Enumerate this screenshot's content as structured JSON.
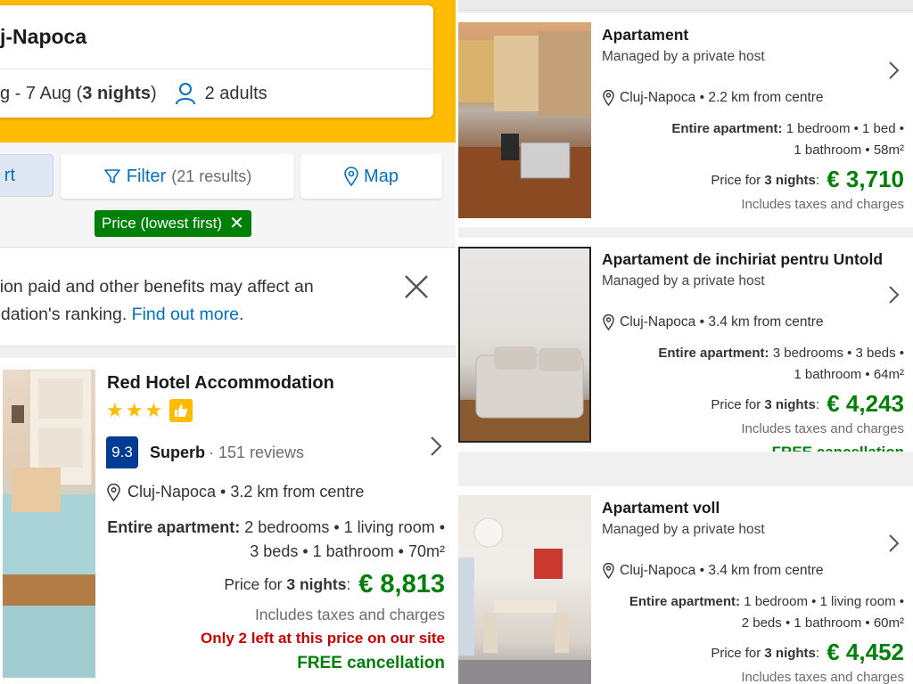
{
  "search": {
    "destination": "j-Napoca",
    "dates_prefix": "g - 7 Aug (",
    "nights": "3 nights",
    "dates_suffix": ")",
    "guests": "2 adults"
  },
  "toolbar": {
    "sort_label": "rt",
    "filter_label": "Filter",
    "filter_count": "(21 results)",
    "map_label": "Map",
    "active_filter_chip": "Price (lowest first)"
  },
  "notice": {
    "line1": "sion paid and other benefits may affect an",
    "line2_prefix": "odation's ranking.",
    "link": "Find out more",
    "line2_suffix": "."
  },
  "hotel": {
    "name": "Red Hotel Accommodation",
    "stars": 3,
    "score": "9.3",
    "score_label": "Superb",
    "reviews": "· 151 reviews",
    "location": "Cluj-Napoca • 3.2 km from centre",
    "apt_label": "Entire apartment:",
    "apt_details_1": "2 bedrooms • 1 living room •",
    "apt_details_2": "3 beds • 1 bathroom • 70m²",
    "price_prefix": "Price for",
    "price_nights": "3 nights",
    "price_sep": ":",
    "price": "€ 8,813",
    "taxes": "Includes taxes and charges",
    "scarcity": "Only 2 left at this price on our site",
    "cancellation": "FREE cancellation"
  },
  "listings": [
    {
      "name": "Apartament",
      "host": "Managed by a private host",
      "location": "Cluj-Napoca • 2.2 km from centre",
      "apt_label": "Entire apartment:",
      "details_1": "1 bedroom • 1 bed •",
      "details_2": "1 bathroom • 58m²",
      "price_prefix": "Price for",
      "price_nights": "3 nights",
      "price_sep": ":",
      "price": "€ 3,710",
      "taxes": "Includes taxes and charges",
      "cancellation": ""
    },
    {
      "name": "Apartament de inchiriat pentru Untold",
      "host": "Managed by a private host",
      "location": "Cluj-Napoca • 3.4 km from centre",
      "apt_label": "Entire apartment:",
      "details_1": "3 bedrooms • 3 beds •",
      "details_2": "1 bathroom • 64m²",
      "price_prefix": "Price for",
      "price_nights": "3 nights",
      "price_sep": ":",
      "price": "€ 4,243",
      "taxes": "Includes taxes and charges",
      "cancellation": "FREE cancellation"
    },
    {
      "name": "Apartament voll",
      "host": "Managed by a private host",
      "location": "Cluj-Napoca • 3.4 km from centre",
      "apt_label": "Entire apartment:",
      "details_1": "1 bedroom • 1 living room •",
      "details_2": "2 beds • 1 bathroom • 60m²",
      "price_prefix": "Price for",
      "price_nights": "3 nights",
      "price_sep": ":",
      "price": "€ 4,452",
      "taxes": "Includes taxes and charges",
      "cancellation": ""
    }
  ],
  "colors": {
    "brand_yellow": "#febb02",
    "link_blue": "#0071c2",
    "score_navy": "#003b95",
    "price_green": "#008009",
    "alert_red": "#cc0000"
  },
  "icons": [
    "person-icon",
    "filter-icon",
    "map-pin-icon",
    "close-icon",
    "star-icon",
    "thumbs-up-icon",
    "chevron-right-icon",
    "location-pin-icon"
  ]
}
